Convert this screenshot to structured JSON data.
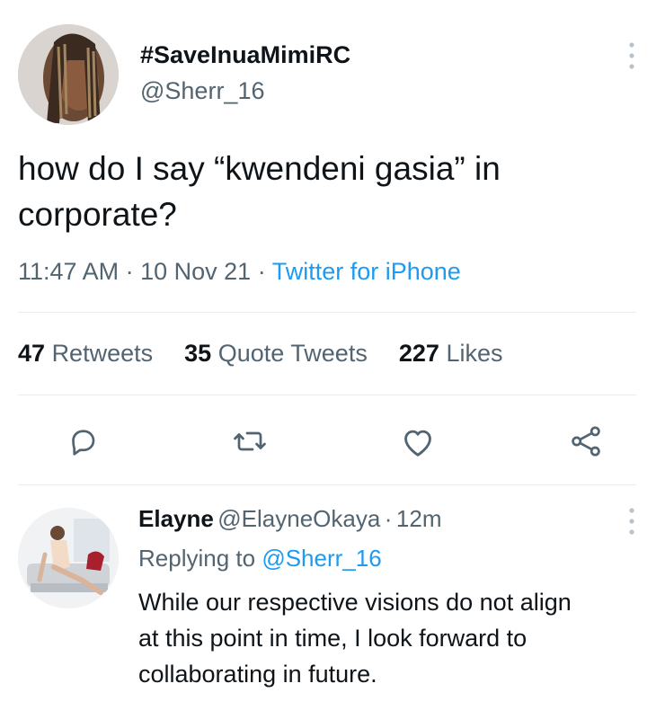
{
  "tweet": {
    "display_name": "#SaveInuaMimiRC",
    "handle": "@Sherr_16",
    "text_line1": "how do I say “kwendeni gasia” in",
    "text_line2": "corporate?",
    "time": "11:47 AM",
    "date": "10 Nov 21",
    "source": "Twitter for iPhone",
    "stats": {
      "retweets_count": "47",
      "retweets_label": "Retweets",
      "quotes_count": "35",
      "quotes_label": "Quote Tweets",
      "likes_count": "227",
      "likes_label": "Likes"
    }
  },
  "reply": {
    "display_name": "Elayne",
    "handle": "@ElayneOkaya",
    "age": "12m",
    "replying_prefix": "Replying to",
    "replying_to": "@Sherr_16",
    "text_line1": "While our respective visions do not align",
    "text_line2": "at this point in time, I look forward to",
    "text_line3": "collaborating in future."
  },
  "icons": {
    "reply": "reply-icon",
    "retweet": "retweet-icon",
    "like": "heart-icon",
    "share": "share-icon",
    "more": "more-vertical-icon"
  },
  "colors": {
    "link": "#1d9bf0",
    "secondary_text": "#536471",
    "primary_text": "#0f1419"
  }
}
